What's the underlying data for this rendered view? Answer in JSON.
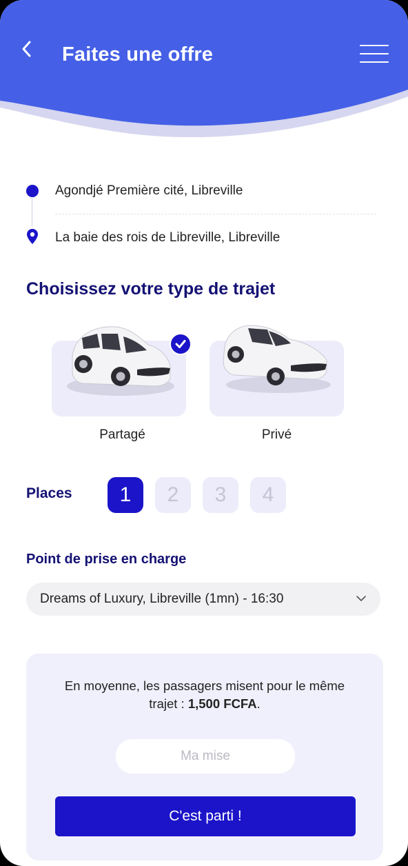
{
  "header": {
    "title": "Faites une offre",
    "back_icon": "chevron-left-icon",
    "menu_icon": "hamburger-menu-icon"
  },
  "route": {
    "origin": "Agondjé Première cité, Libreville",
    "destination": "La baie des rois de Libreville, Libreville"
  },
  "trip_type": {
    "title": "Choisissez votre type de trajet",
    "options": [
      {
        "label": "Partagé",
        "icon": "minivan-icon",
        "selected": true
      },
      {
        "label": "Privé",
        "icon": "sedan-icon",
        "selected": false
      }
    ]
  },
  "places": {
    "label": "Places",
    "options": [
      "1",
      "2",
      "3",
      "4"
    ],
    "selected": "1"
  },
  "pickup": {
    "label": "Point de prise en charge",
    "value": "Dreams of Luxury, Libreville (1mn) - 16:30"
  },
  "offer": {
    "text_prefix": "En moyenne, les passagers misent pour le même trajet : ",
    "average_amount": "1,500 FCFA",
    "text_suffix": ".",
    "input_placeholder": "Ma mise",
    "submit_label": "C'est parti !"
  },
  "colors": {
    "primary": "#1b14c9",
    "header_blue": "#4560e6",
    "heading": "#141173",
    "card_bg": "#ececfb"
  }
}
